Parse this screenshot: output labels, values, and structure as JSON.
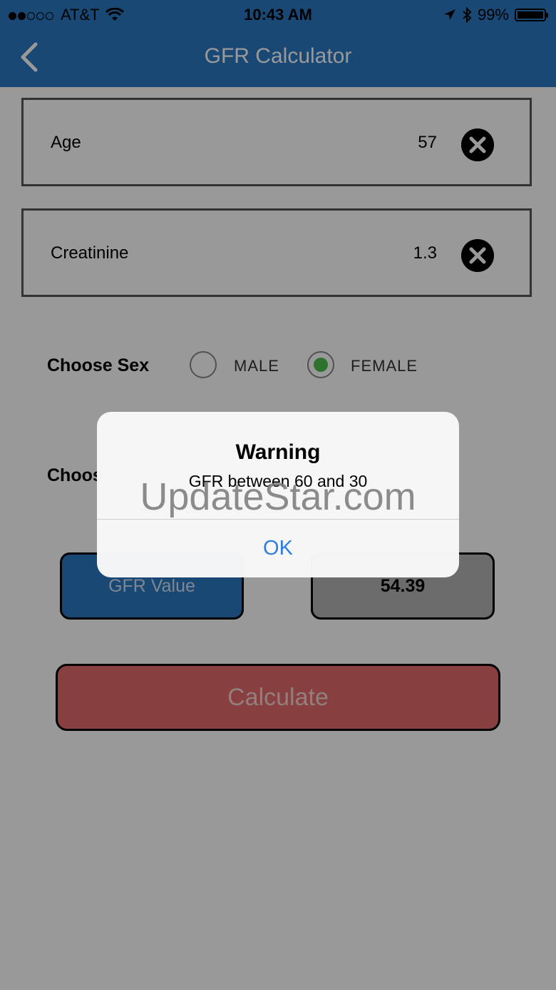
{
  "status_bar": {
    "carrier": "AT&T",
    "time": "10:43 AM",
    "battery": "99%",
    "icons": [
      "signal-dots-icon",
      "wifi-icon",
      "location-arrow-icon",
      "bluetooth-icon",
      "battery-icon"
    ]
  },
  "nav": {
    "title": "GFR Calculator",
    "back_icon": "chevron-left-icon"
  },
  "form": {
    "age": {
      "label": "Age",
      "value": "57"
    },
    "creatinine": {
      "label": "Creatinine",
      "value": "1.3"
    },
    "sex": {
      "label": "Choose Sex",
      "options": [
        "MALE",
        "FEMALE"
      ],
      "selected": "FEMALE"
    },
    "second_label_partial": "Choos",
    "gfr_label": "GFR Value",
    "gfr_result": "54.39",
    "calculate_label": "Calculate"
  },
  "alert": {
    "title": "Warning",
    "message": "GFR between 60 and 30",
    "ok_label": "OK"
  },
  "watermark": "UpdateStar.com",
  "colors": {
    "nav_blue": "#2b79c2",
    "calculate_red": "#e26a6a",
    "radio_selected_green": "#4cc04c",
    "alert_button_blue": "#2f7de1"
  }
}
